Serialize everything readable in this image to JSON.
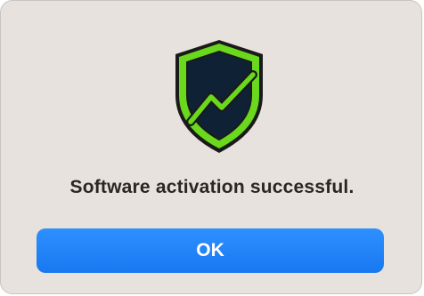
{
  "dialog": {
    "message": "Software activation successful.",
    "ok_label": "OK"
  },
  "icons": {
    "app_icon": "shield-icon"
  },
  "colors": {
    "dialog_background": "#e7e2dd",
    "button_blue": "#1c7ef5",
    "shield_green": "#6ad81c",
    "shield_dark": "#0f2134"
  }
}
